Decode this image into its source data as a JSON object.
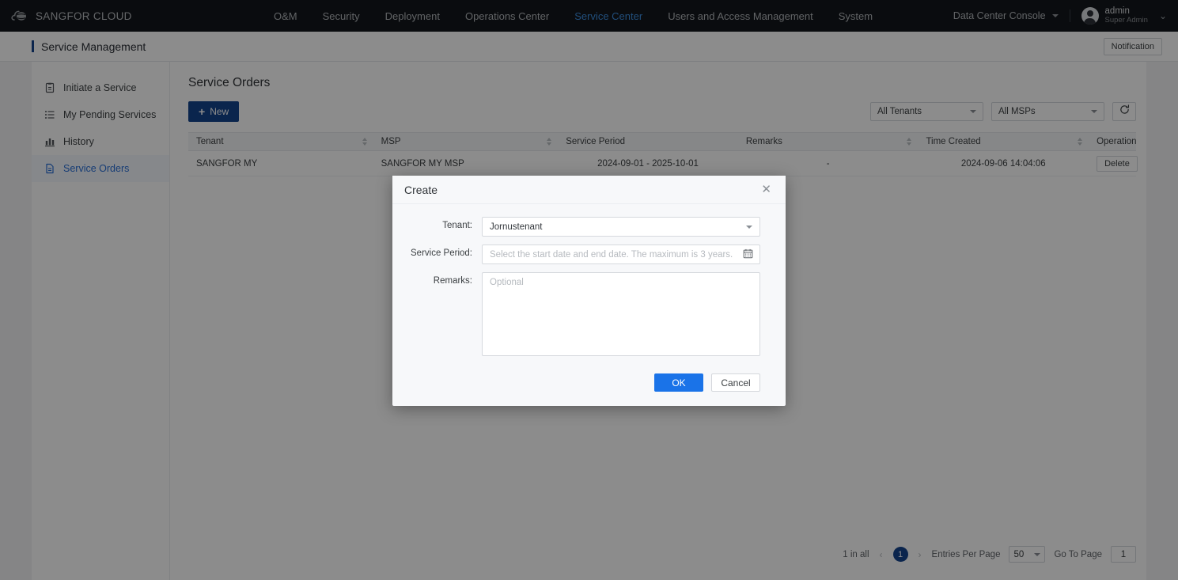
{
  "topnav": {
    "brand": "SANGFOR CLOUD",
    "brand_logo_icon": "cloud-logo-icon",
    "items": [
      {
        "label": "O&M",
        "active": false
      },
      {
        "label": "Security",
        "active": false
      },
      {
        "label": "Deployment",
        "active": false
      },
      {
        "label": "Operations Center",
        "active": false
      },
      {
        "label": "Service Center",
        "active": true
      },
      {
        "label": "Users and Access Management",
        "active": false
      },
      {
        "label": "System",
        "active": false
      }
    ],
    "console_selector": "Data Center Console",
    "user": {
      "name": "admin",
      "role": "Super Admin"
    },
    "accent_active": "#3d8ee0",
    "background": "#13171c"
  },
  "pagehead": {
    "title": "Service Management",
    "accent_bar": "#14448c",
    "notification_label": "Notification"
  },
  "sidebar": {
    "items": [
      {
        "label": "Initiate a Service",
        "icon": "form-icon",
        "active": false
      },
      {
        "label": "My Pending Services",
        "icon": "list-icon",
        "active": false
      },
      {
        "label": "History",
        "icon": "bar-chart-icon",
        "active": false
      },
      {
        "label": "Service Orders",
        "icon": "document-icon",
        "active": true
      }
    ],
    "active_color": "#2a6fd6"
  },
  "main": {
    "title": "Service Orders",
    "new_button": "New",
    "new_button_color": "#13448c",
    "filters": {
      "tenant_filter": "All Tenants",
      "msp_filter": "All MSPs",
      "refresh_icon": "refresh-icon"
    },
    "table": {
      "columns": [
        {
          "label": "Tenant",
          "sortable": true
        },
        {
          "label": "MSP",
          "sortable": true
        },
        {
          "label": "Service Period",
          "sortable": false
        },
        {
          "label": "Remarks",
          "sortable": true
        },
        {
          "label": "Time Created",
          "sortable": true
        },
        {
          "label": "Operation",
          "sortable": false
        }
      ],
      "rows": [
        {
          "tenant": "SANGFOR MY",
          "msp": "SANGFOR MY MSP",
          "service_period": "2024-09-01 - 2025-10-01",
          "remarks": "-",
          "time_created": "2024-09-06 14:04:06",
          "operation": "Delete"
        }
      ]
    },
    "pagination": {
      "total_text": "1 in all",
      "prev_icon": "chevron-left-icon",
      "next_icon": "chevron-right-icon",
      "current_page": "1",
      "entries_label": "Entries Per Page",
      "entries_value": "50",
      "goto_label": "Go To Page",
      "goto_value": "1",
      "active_color": "#14448c"
    }
  },
  "modal": {
    "title": "Create",
    "close_icon": "close-icon",
    "fields": {
      "tenant_label": "Tenant:",
      "tenant_value": "Jornustenant",
      "service_period_label": "Service Period:",
      "service_period_placeholder": "Select the start date and end date. The maximum is 3 years.",
      "calendar_icon": "calendar-icon",
      "remarks_label": "Remarks:",
      "remarks_placeholder": "Optional",
      "remarks_value": ""
    },
    "ok_label": "OK",
    "cancel_label": "Cancel",
    "ok_color": "#1a73e8"
  }
}
